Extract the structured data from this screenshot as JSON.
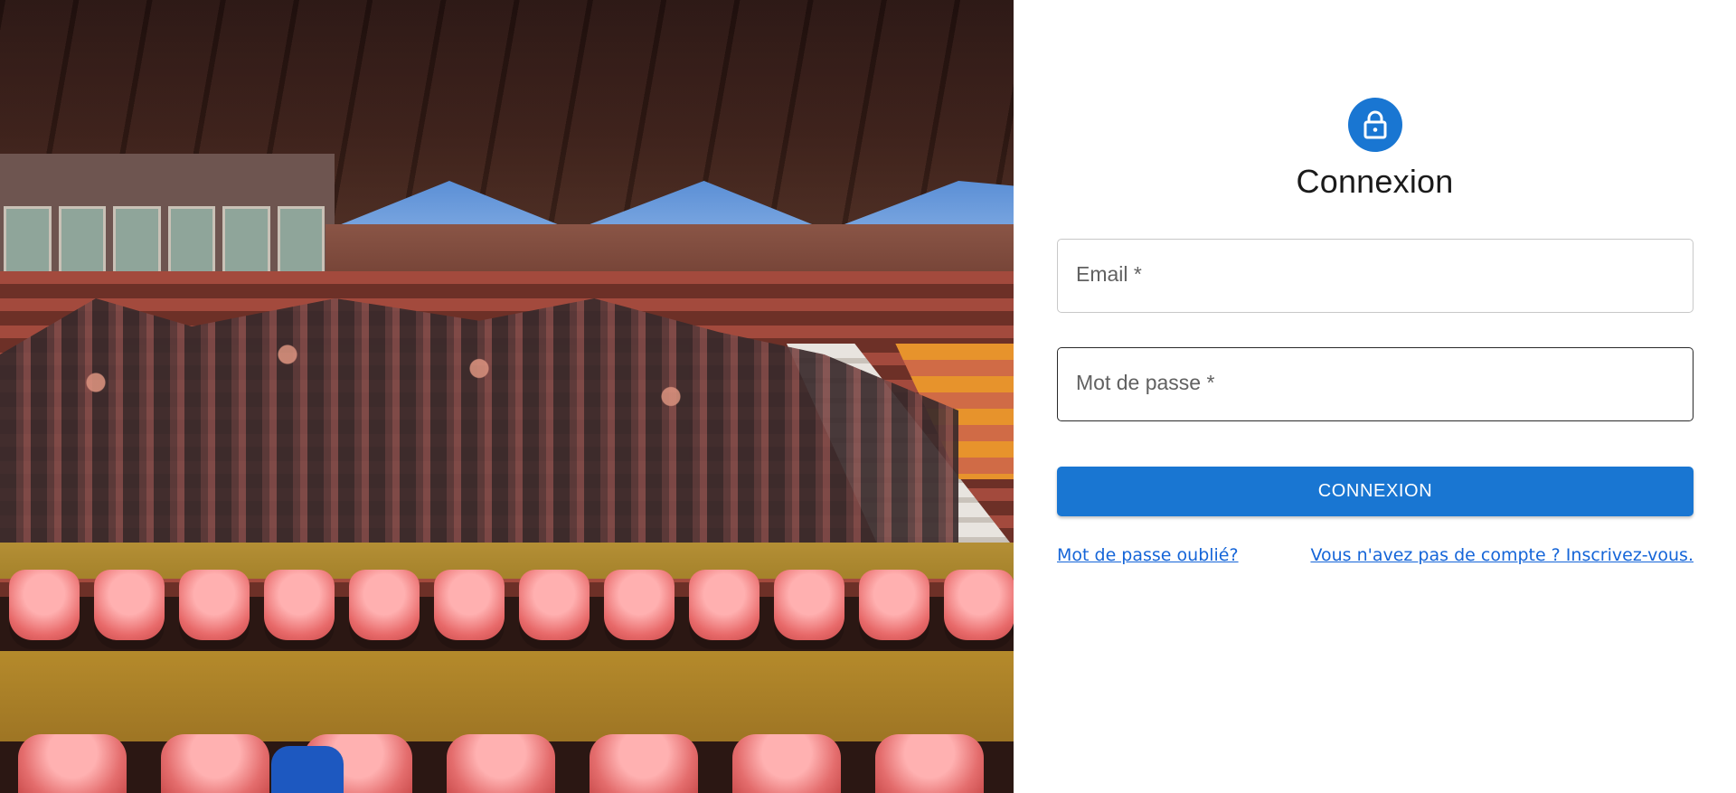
{
  "hero": {
    "image_description_name": "stadium-group-photo"
  },
  "login": {
    "icon": "lock-icon",
    "title": "Connexion",
    "email_label": "Email *",
    "password_label": "Mot de passe *",
    "submit_label": "CONNEXION",
    "forgot_password_link": "Mot de passe oublié?",
    "signup_link": "Vous n'avez pas de compte ? Inscrivez-vous."
  },
  "colors": {
    "primary": "#1976d2",
    "link": "#1565d8",
    "text": "#1a1a1a"
  }
}
